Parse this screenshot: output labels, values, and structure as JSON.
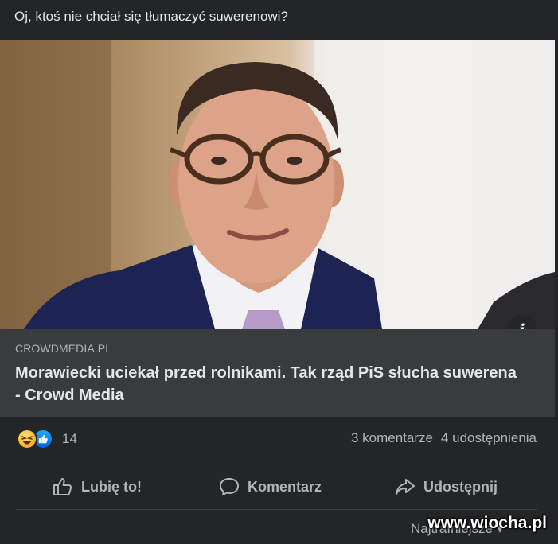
{
  "post": {
    "text": "Oj, ktoś nie chciał się tłumaczyć suwerenowi?"
  },
  "link_preview": {
    "domain": "CROWDMEDIA.PL",
    "headline": "Morawiecki uciekał przed rolnikami. Tak rząd PiS słucha suwerena - Crowd Media",
    "info_icon": "info-icon"
  },
  "stats": {
    "reaction_icons": [
      "haha-reaction-icon",
      "like-reaction-icon"
    ],
    "reaction_count": "14",
    "comments": "3 komentarze",
    "shares": "4 udostępnienia"
  },
  "actions": {
    "like_label": "Lubię to!",
    "comment_label": "Komentarz",
    "share_label": "Udostępnij"
  },
  "comments_sort": {
    "label": "Najtrafniejsze"
  },
  "watermark": "www.wiocha.pl",
  "colors": {
    "background": "#242526",
    "card": "#3a3b3c",
    "text_primary": "#e4e6eb",
    "text_secondary": "#b0b3b8",
    "like_blue": "#1877f2"
  }
}
